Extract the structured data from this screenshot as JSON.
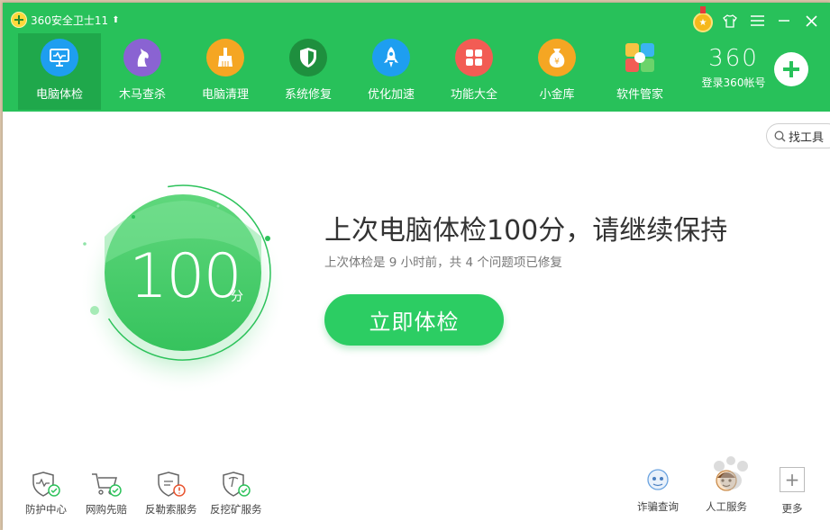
{
  "window": {
    "title": "360安全卫士11",
    "up_arrow": "⬆"
  },
  "nav": [
    {
      "label": "电脑体检",
      "icon": "monitor-check-icon",
      "color": "#1e9ef0",
      "active": true
    },
    {
      "label": "木马查杀",
      "icon": "horse-icon",
      "color": "#8a63d2",
      "active": false
    },
    {
      "label": "电脑清理",
      "icon": "broom-icon",
      "color": "#f5a623",
      "active": false
    },
    {
      "label": "系统修复",
      "icon": "shield-icon",
      "color": "#1e8f3e",
      "active": false
    },
    {
      "label": "优化加速",
      "icon": "rocket-icon",
      "color": "#1e9ef0",
      "active": false
    },
    {
      "label": "功能大全",
      "icon": "grid-icon",
      "color": "#f25c54",
      "active": false
    },
    {
      "label": "小金库",
      "icon": "money-bag-icon",
      "color": "#f5a623",
      "active": false
    },
    {
      "label": "软件管家",
      "icon": "apps-icon",
      "color": "#ffffff",
      "active": false
    }
  ],
  "account": {
    "brand": "360",
    "login": "登录360帐号"
  },
  "find_tools": "找工具",
  "score": {
    "value": "100",
    "unit": "分"
  },
  "main": {
    "headline": "上次电脑体检100分，请继续保持",
    "subline": "上次体检是 9 小时前，共 4 个问题项已修复",
    "check_button": "立即体检"
  },
  "bottom_left": [
    {
      "label": "防护中心",
      "icon": "shield-pulse-icon"
    },
    {
      "label": "网购先赔",
      "icon": "shopping-cart-icon"
    },
    {
      "label": "反勒索服务",
      "icon": "shield-alert-icon"
    },
    {
      "label": "反挖矿服务",
      "icon": "shield-pick-icon"
    }
  ],
  "bottom_right": [
    {
      "label": "诈骗查询",
      "icon": "fraud-query-icon"
    },
    {
      "label": "人工服务",
      "icon": "customer-service-icon"
    },
    {
      "label": "更多",
      "icon": "plus-icon"
    }
  ],
  "colors": {
    "header_green": "#28c15a",
    "active_tab": "#1fa84b",
    "button_green": "#2ccd63"
  }
}
